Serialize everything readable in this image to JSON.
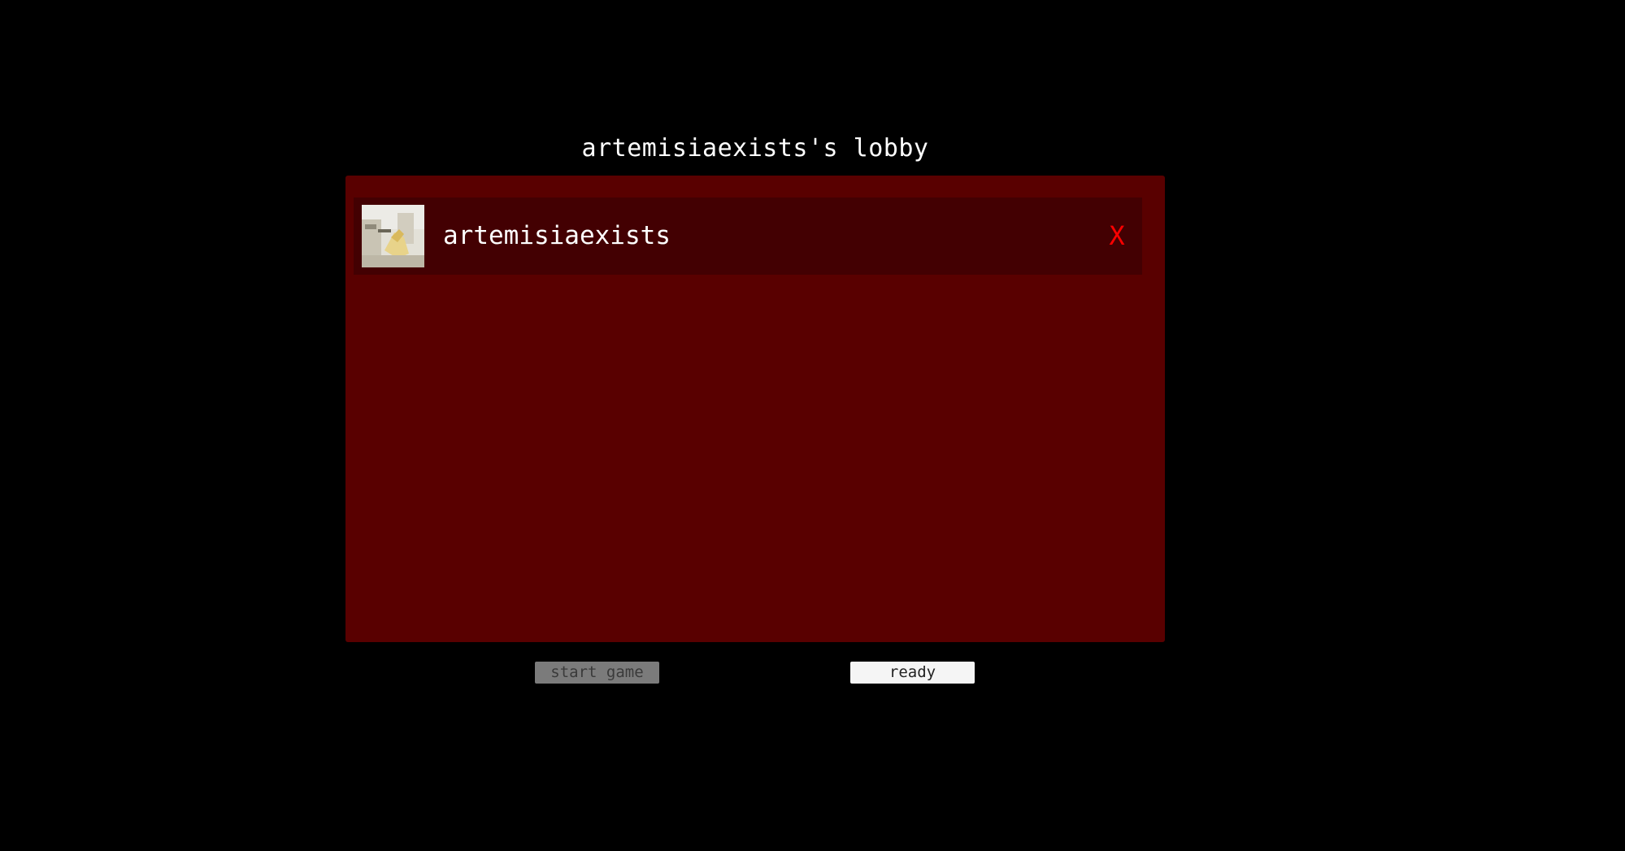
{
  "lobby": {
    "title": "artemisiaexists's lobby"
  },
  "players": [
    {
      "name": "artemisiaexists",
      "kick_label": "X",
      "avatar_icon": "player-avatar-thumbnail"
    }
  ],
  "buttons": {
    "start_game": "start game",
    "ready": "ready"
  },
  "colors": {
    "background": "#000000",
    "panel": "#590000",
    "player_row": "#430002",
    "kick": "#ff0000",
    "start_button_disabled": "#7b7b7b",
    "ready_button": "#f5f5f5"
  }
}
